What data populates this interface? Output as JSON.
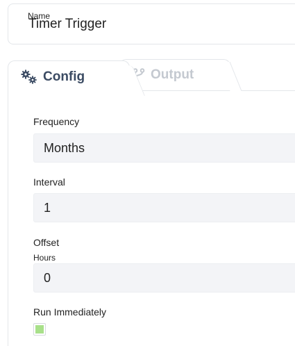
{
  "name_field": {
    "label": "Name",
    "value": "Timer Trigger"
  },
  "tabs": [
    {
      "label": "Config",
      "icon": "gears-icon",
      "active": true
    },
    {
      "label": "Output",
      "icon": "branch-icon",
      "active": false
    }
  ],
  "config": {
    "frequency": {
      "label": "Frequency",
      "value": "Months"
    },
    "interval": {
      "label": "Interval",
      "value": "1"
    },
    "offset": {
      "label": "Offset",
      "sub_label": "Hours",
      "value": "0"
    },
    "run_immediately": {
      "label": "Run Immediately",
      "checked": true
    }
  },
  "colors": {
    "active_tab_text": "#3b4b63",
    "inactive_tab_text": "#c4c9d0",
    "field_bg": "#f3f4f7",
    "checkbox_fill": "#a8e08a"
  }
}
